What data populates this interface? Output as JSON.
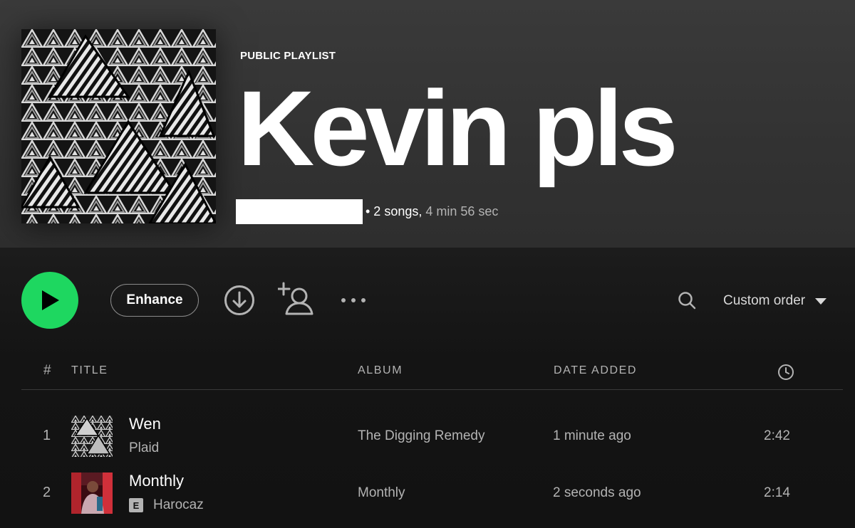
{
  "header": {
    "type_label": "PUBLIC PLAYLIST",
    "title": "Kevin pls",
    "meta_songs": "• 2 songs,",
    "meta_duration": " 4 min 56 sec"
  },
  "actions": {
    "enhance_label": "Enhance",
    "download_icon": "download-circle-icon",
    "add_user_icon": "add-user-icon",
    "more_icon": "more-horizontal-icon",
    "search_icon": "search-icon",
    "sort_label": "Custom order"
  },
  "table": {
    "headers": {
      "number": "#",
      "title": "TITLE",
      "album": "ALBUM",
      "date_added": "DATE ADDED",
      "duration_icon": "clock-icon"
    },
    "rows": [
      {
        "number": "1",
        "title": "Wen",
        "artist": "Plaid",
        "explicit": false,
        "album": "The Digging Remedy",
        "date_added": "1 minute ago",
        "duration": "2:42"
      },
      {
        "number": "2",
        "title": "Monthly",
        "artist": "Harocaz",
        "explicit": true,
        "explicit_label": "E",
        "album": "Monthly",
        "date_added": "2 seconds ago",
        "duration": "2:14"
      }
    ]
  },
  "colors": {
    "accent": "#1ed760",
    "background": "#121212",
    "text_dim": "#b3b3b3"
  }
}
